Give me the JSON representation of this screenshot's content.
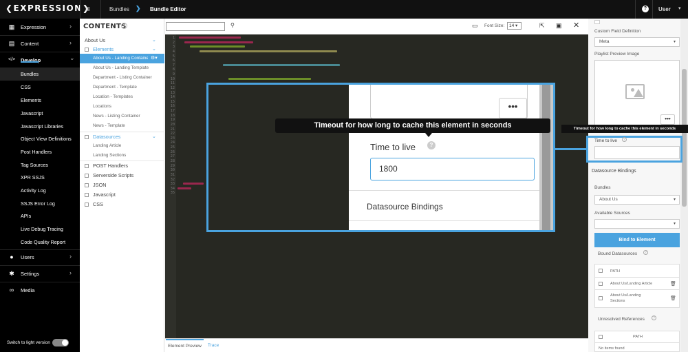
{
  "topbar": {
    "logo": "❮EXPRESSION❯",
    "menu_icon": "hamburger-icon",
    "breadcrumb": [
      "Bundles",
      "Bundle Editor"
    ],
    "breadcrumb_sep": "❯",
    "help": "?",
    "user": "User",
    "user_caret": "▾"
  },
  "nav": {
    "items": [
      {
        "label": "Expression",
        "icon": "cube-icon",
        "glyph": "▦"
      },
      {
        "label": "Content",
        "icon": "document-icon",
        "glyph": "▤"
      },
      {
        "label": "Develop",
        "icon": "code-icon",
        "glyph": "</>"
      }
    ],
    "sub": [
      "Bundles",
      "CSS",
      "Elements",
      "Javascript",
      "Javascript Libraries",
      "Object View Definitions",
      "Post Handlers",
      "Tag Sources",
      "XPR SSJS",
      "Activity Log",
      "SSJS Error Log",
      "APIs",
      "Live Debug Tracing",
      "Code Quality Report"
    ],
    "bottom": [
      {
        "label": "Users",
        "icon": "user-icon",
        "glyph": "●"
      },
      {
        "label": "Settings",
        "icon": "gear-icon",
        "glyph": "✱"
      },
      {
        "label": "Media",
        "icon": "link-icon",
        "glyph": "∞"
      }
    ],
    "chevron": "›",
    "chevron_down": "⌄",
    "toggle_label": "Switch to light version"
  },
  "contents": {
    "title": "CONTENTS",
    "help": "?",
    "about_us": "About Us",
    "elements": "Elements",
    "element_items": [
      "About Us - Landing Container",
      "About Us - Landing Template",
      "Department - Listing Container",
      "Department - Template",
      "Location - Templates",
      "Locations",
      "News - Listing Container",
      "News - Template"
    ],
    "datasources": "Datasources",
    "datasource_items": [
      "Landing Article",
      "Landing Sections"
    ],
    "groups": [
      "POST Handlers",
      "Serverside Scripts",
      "JSON",
      "Javascript",
      "CSS"
    ]
  },
  "toolbar": {
    "search_placeholder": "",
    "font_size_label": "Font Size:",
    "font_size_value": "14 ▾"
  },
  "editor": {
    "line_count": 35,
    "tabs": [
      "Element Preview",
      "Trace"
    ]
  },
  "zoom": {
    "dots": "•••",
    "tooltip": "Timeout for how long to cache this element in seconds",
    "field_label": "Time to live",
    "help": "?",
    "field_value": "1800",
    "section": "Datasource Bindings"
  },
  "right": {
    "custom_field_label": "Custom Field Definition",
    "custom_field_value": "Meta",
    "playlist_label": "Playlist Preview Image",
    "dots": "•••",
    "tooltip": "Timeout for how long to cache this element in seconds",
    "ttl_label": "Time to live",
    "ttl_value": "",
    "ds_bindings": "Datasource Bindings",
    "bundles_label": "Bundles",
    "bundles_value": "About Us",
    "available_label": "Available Sources",
    "available_value": "",
    "bind_button": "Bind to Element",
    "bound_label": "Bound Datasources",
    "path_header": "PATH",
    "bound_rows": [
      "About Us/Landing Article",
      "About Us/Landing Sections"
    ],
    "unresolved_label": "Unresolved References",
    "unresolved_path": "PATH",
    "no_items": "No items found",
    "help": "?",
    "caret": "▾",
    "trash": "🗑"
  }
}
